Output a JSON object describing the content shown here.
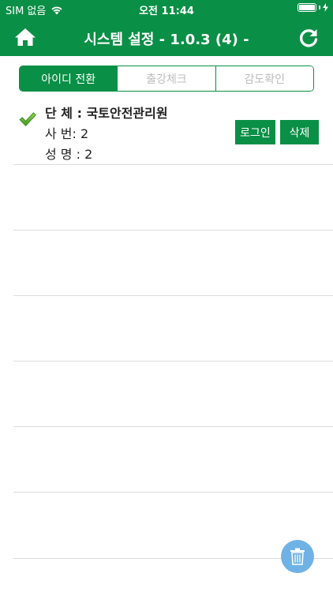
{
  "status_bar": {
    "carrier": "SIM 없음",
    "time": "오전 11:44"
  },
  "header": {
    "title": "시스템 설정 - 1.0.3 (4) -",
    "home_icon": "home-icon",
    "refresh_icon": "refresh-icon"
  },
  "tabs": [
    {
      "label": "아이디 전환",
      "active": true
    },
    {
      "label": "출강체크",
      "active": false
    },
    {
      "label": "감도확인",
      "active": false
    }
  ],
  "accounts": [
    {
      "org": "단 체 : 국토안전관리원",
      "emp_no": "사 번: 2",
      "name": "성 명 : 2",
      "selected": true,
      "login_label": "로그인",
      "delete_label": "삭제"
    }
  ],
  "fab": {
    "icon": "trash-icon"
  },
  "colors": {
    "primary": "#0a8f46",
    "fab": "#6fb2e6"
  }
}
